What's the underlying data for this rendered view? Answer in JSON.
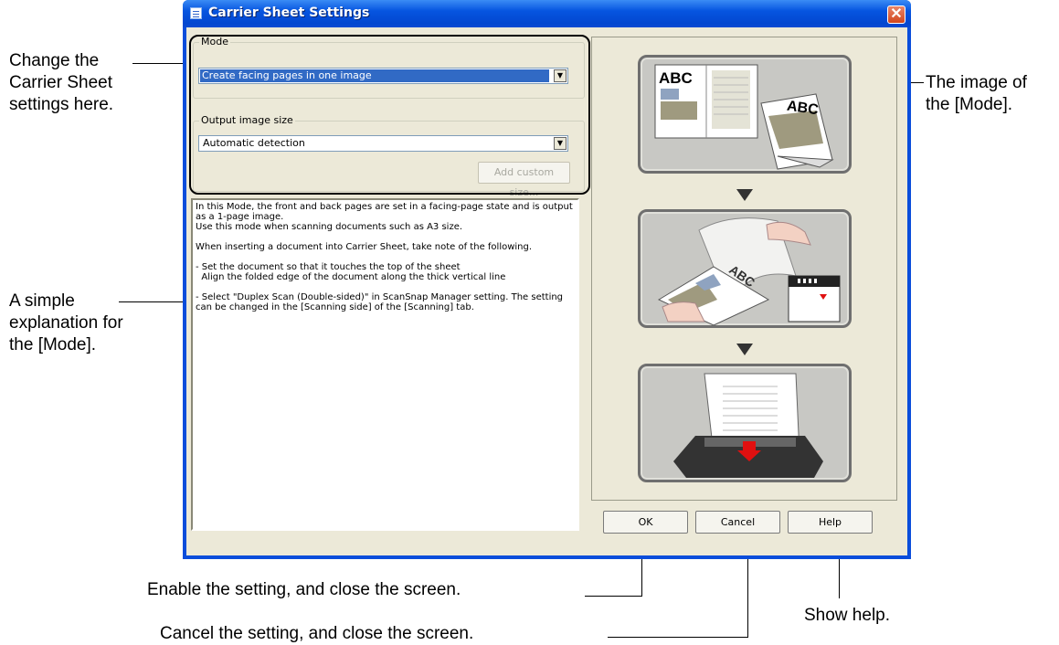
{
  "window": {
    "title": "Carrier Sheet Settings",
    "close_label": "✕"
  },
  "mode": {
    "label": "Mode",
    "value": "Create facing pages in one image"
  },
  "output": {
    "label": "Output image size",
    "value": "Automatic detection",
    "add_custom_label": "Add custom size..."
  },
  "description": "In this Mode, the front and back pages are set in a facing-page state and is output\nas a 1-page image.\nUse this mode when scanning documents such as A3 size.\n\nWhen inserting a document into Carrier Sheet, take note of the following.\n\n- Set the document so that it touches the top of the sheet\n  Align the folded edge of the document along the thick vertical line\n\n- Select \"Duplex Scan (Double-sided)\" in ScanSnap Manager setting. The setting\ncan be changed in the [Scanning side] of the [Scanning] tab.",
  "preview": {
    "abc1": "ABC",
    "abc2": "ABC"
  },
  "buttons": {
    "ok": "OK",
    "cancel": "Cancel",
    "help": "Help"
  },
  "callouts": {
    "change_settings": [
      "Change the",
      "Carrier Sheet",
      "settings here."
    ],
    "explanation": [
      "A simple",
      "explanation for",
      "the [Mode]."
    ],
    "image_of_mode": [
      "The image of",
      "the [Mode]."
    ],
    "ok_desc": "Enable the setting, and close the screen.",
    "cancel_desc": "Cancel the setting, and close the screen.",
    "help_desc": "Show help."
  },
  "colors": {
    "titlebar": "#0655e0",
    "dialog_bg": "#ece9d8",
    "selection": "#316ac5",
    "close": "#d2461d",
    "accent_red": "#e01010"
  }
}
